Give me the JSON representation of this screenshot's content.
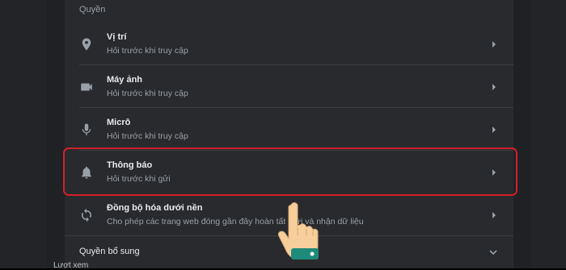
{
  "section_title": "Quyền",
  "permissions": [
    {
      "title": "Vị trí",
      "subtitle": "Hỏi trước khi truy cập",
      "icon": "location-pin-icon"
    },
    {
      "title": "Máy ảnh",
      "subtitle": "Hỏi trước khi truy cập",
      "icon": "camera-icon"
    },
    {
      "title": "Micrô",
      "subtitle": "Hỏi trước khi truy cập",
      "icon": "microphone-icon"
    },
    {
      "title": "Thông báo",
      "subtitle": "Hỏi trước khi gửi",
      "icon": "bell-icon"
    },
    {
      "title": "Đồng bộ hóa dưới nền",
      "subtitle": "Cho phép các trang web đóng gần đây hoàn tất g ửi và nhận dữ liệu",
      "icon": "sync-icon"
    }
  ],
  "additional": {
    "label": "Quyền bổ sung"
  },
  "cut_text": "Lượt xem",
  "colors": {
    "highlight": "#d21f2b",
    "background": "#202124",
    "card": "#292a2d"
  }
}
